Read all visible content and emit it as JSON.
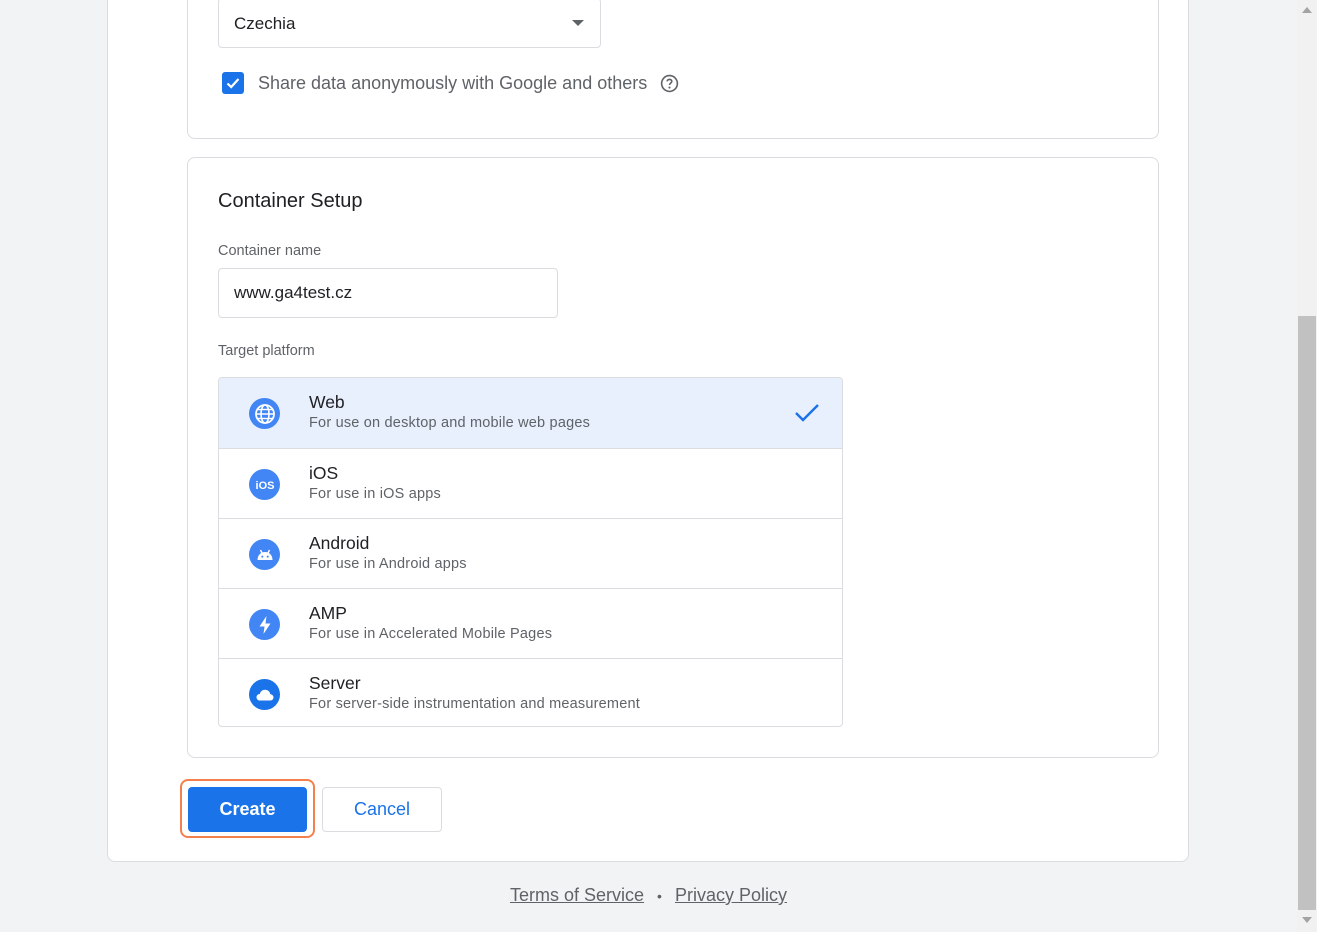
{
  "account": {
    "country_value": "Czechia",
    "share_data_label": "Share data anonymously with Google and others",
    "share_data_checked": true
  },
  "container": {
    "section_title": "Container Setup",
    "name_label": "Container name",
    "name_value": "www.ga4test.cz",
    "platform_label": "Target platform",
    "platforms": [
      {
        "name": "Web",
        "description": "For use on desktop and mobile web pages",
        "icon": "globe-icon",
        "selected": true
      },
      {
        "name": "iOS",
        "description": "For use in iOS apps",
        "icon": "ios-icon",
        "selected": false
      },
      {
        "name": "Android",
        "description": "For use in Android apps",
        "icon": "android-icon",
        "selected": false
      },
      {
        "name": "AMP",
        "description": "For use in Accelerated Mobile Pages",
        "icon": "lightning-icon",
        "selected": false
      },
      {
        "name": "Server",
        "description": "For server-side instrumentation and measurement",
        "icon": "cloud-icon",
        "selected": false
      }
    ]
  },
  "actions": {
    "create_label": "Create",
    "cancel_label": "Cancel"
  },
  "footer": {
    "terms_label": "Terms of Service",
    "separator": "•",
    "privacy_label": "Privacy Policy"
  },
  "colors": {
    "primary": "#1a73e8",
    "icon_blue": "#4285f4",
    "selected_bg": "#e8f0fe",
    "focus_ring": "#f4804d"
  }
}
